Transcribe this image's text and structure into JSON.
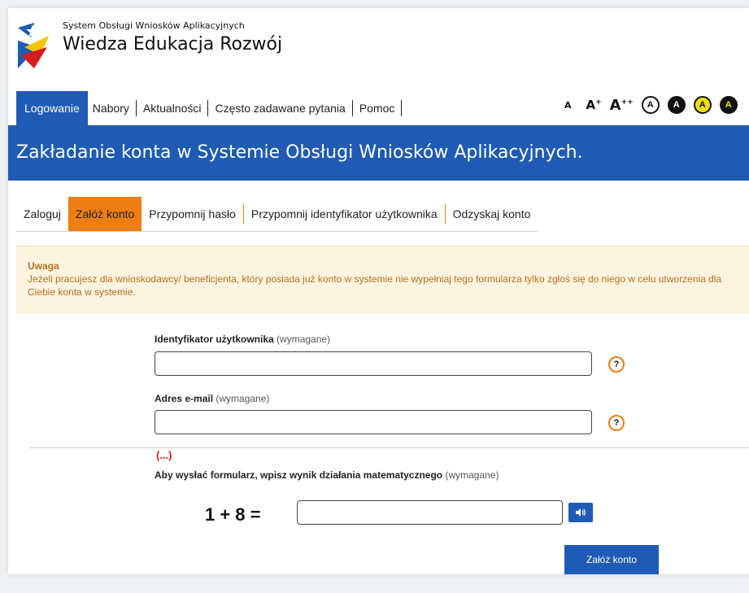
{
  "header": {
    "system_name_small": "System Obsługi Wniosków Aplikacyjnych",
    "system_name_big": "Wiedza Edukacja Rozwój"
  },
  "nav": {
    "items": [
      {
        "label": "Logowanie",
        "active": true
      },
      {
        "label": "Nabory"
      },
      {
        "label": "Aktualności"
      },
      {
        "label": "Często zadawane pytania"
      },
      {
        "label": "Pomoc"
      }
    ]
  },
  "accessibility": {
    "font_small": "A",
    "font_medium": "A",
    "font_medium_sup": "+",
    "font_large": "A",
    "font_large_sup": "++",
    "contrast_labels": [
      "A",
      "A",
      "A",
      "A"
    ]
  },
  "banner": {
    "title": "Zakładanie konta w Systemie Obsługi Wniosków Aplikacyjnych."
  },
  "tabs": [
    {
      "label": "Zaloguj"
    },
    {
      "label": "Załóż konto",
      "active": true
    },
    {
      "label": "Przypomnij hasło"
    },
    {
      "label": "Przypomnij identyfikator użytkownika"
    },
    {
      "label": "Odzyskaj konto"
    }
  ],
  "notice": {
    "title": "Uwaga",
    "text": "Jeżeli pracujesz dla wnioskodawcy/ beneficjenta, który posiada już konto w systemie nie wypełniaj tego formularza tylko zgłoś się do niego w celu utworzenia dla Ciebie konta w systemie."
  },
  "form": {
    "user_id_label": "Identyfikator użytkownika",
    "user_id_req": "(wymagane)",
    "user_id_value": "",
    "email_label": "Adres e-mail",
    "email_req": "(wymagane)",
    "email_value": "",
    "help_glyph": "?",
    "ellipsis": "(...)",
    "captcha_label": "Aby wysłać formularz, wpisz wynik działania matematycznego",
    "captcha_req": "(wymagane)",
    "captcha_expression": "1 + 8 =",
    "captcha_value": "",
    "submit_label": "Załóż konto"
  },
  "colors": {
    "primary": "#1f5bb5",
    "accent": "#ee7d14",
    "notice_bg": "#fdf3e1",
    "notice_text": "#b5711c",
    "error": "#d41c1c"
  }
}
